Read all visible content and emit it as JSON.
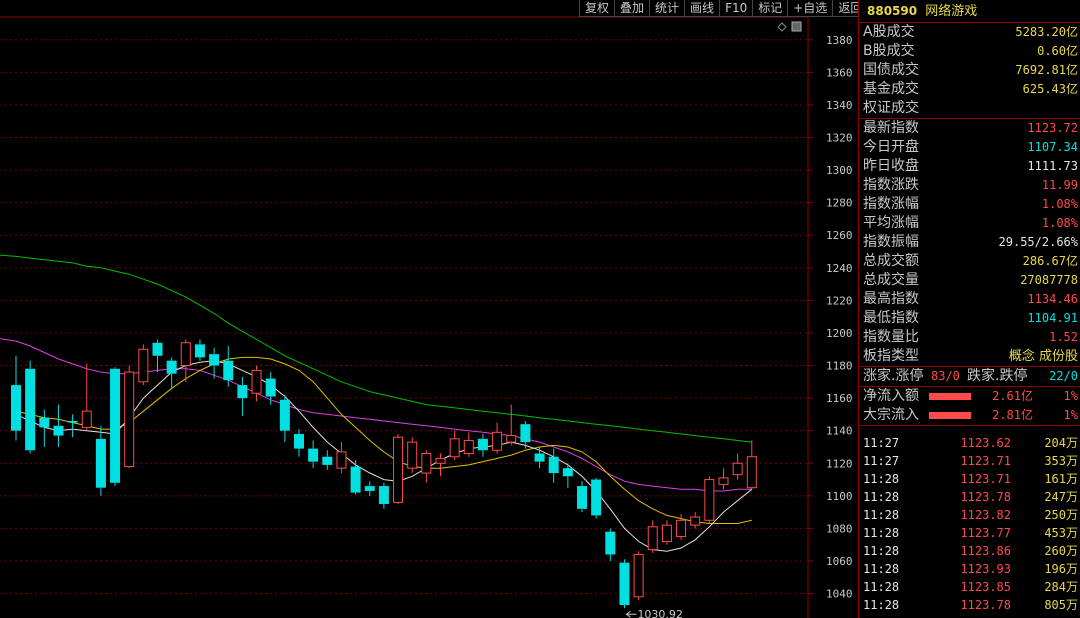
{
  "toolbar": [
    "复权",
    "叠加",
    "统计",
    "画线",
    "F10",
    "标记",
    "+自选",
    "返回"
  ],
  "panel": {
    "code": "880590",
    "name": "网络游戏",
    "turnover": [
      {
        "label": "A股成交",
        "value": "5283.20亿"
      },
      {
        "label": "B股成交",
        "value": "0.60亿"
      },
      {
        "label": "国债成交",
        "value": "7692.81亿"
      },
      {
        "label": "基金成交",
        "value": "625.43亿"
      },
      {
        "label": "权证成交",
        "value": ""
      }
    ],
    "stats": [
      {
        "label": "最新指数",
        "value": "1123.72",
        "color": "r"
      },
      {
        "label": "今日开盘",
        "value": "1107.34",
        "color": "c"
      },
      {
        "label": "昨日收盘",
        "value": "1111.73",
        "color": "w"
      },
      {
        "label": "指数涨跌",
        "value": "11.99",
        "color": "r"
      },
      {
        "label": "指数涨幅",
        "value": "1.08%",
        "color": "r"
      },
      {
        "label": "平均涨幅",
        "value": "1.08%",
        "color": "r"
      },
      {
        "label": "指数振幅",
        "value": "29.55/2.66%",
        "color": "w"
      },
      {
        "label": "总成交额",
        "value": "286.67亿",
        "color": "y"
      },
      {
        "label": "总成交量",
        "value": "27087778",
        "color": "y"
      },
      {
        "label": "最高指数",
        "value": "1134.46",
        "color": "r"
      },
      {
        "label": "最低指数",
        "value": "1104.91",
        "color": "c"
      },
      {
        "label": "指数量比",
        "value": "1.52",
        "color": "r"
      },
      {
        "label": "板指类型",
        "value": "概念 成份股",
        "color": "y"
      }
    ],
    "updown": {
      "up_label": "涨家.涨停",
      "up_value": "83/0",
      "down_label": "跌家.跌停",
      "down_value": "22/0"
    },
    "flows": [
      {
        "label": "净流入额",
        "amount": "2.61亿",
        "pct": "1%"
      },
      {
        "label": "大宗流入",
        "amount": "2.81亿",
        "pct": "1%"
      }
    ],
    "ticks": [
      {
        "time": "11:27",
        "price": "1123.62",
        "vol": "204万"
      },
      {
        "time": "11:27",
        "price": "1123.71",
        "vol": "353万"
      },
      {
        "time": "11:28",
        "price": "1123.71",
        "vol": "161万"
      },
      {
        "time": "11:28",
        "price": "1123.78",
        "vol": "247万"
      },
      {
        "time": "11:28",
        "price": "1123.82",
        "vol": "250万"
      },
      {
        "time": "11:28",
        "price": "1123.77",
        "vol": "453万"
      },
      {
        "time": "11:28",
        "price": "1123.86",
        "vol": "260万"
      },
      {
        "time": "11:28",
        "price": "1123.93",
        "vol": "196万"
      },
      {
        "time": "11:28",
        "price": "1123.85",
        "vol": "284万"
      },
      {
        "time": "11:28",
        "price": "1123.78",
        "vol": "805万"
      }
    ]
  },
  "chart_data": {
    "type": "candlestick",
    "ylim": [
      1025,
      1394
    ],
    "yticks": [
      1040,
      1060,
      1080,
      1100,
      1120,
      1140,
      1160,
      1180,
      1200,
      1220,
      1240,
      1260,
      1280,
      1300,
      1320,
      1340,
      1360,
      1380
    ],
    "low_annotation": "1030.92",
    "candles": [
      {
        "o": 1168,
        "c": 1140,
        "h": 1186,
        "l": 1134
      },
      {
        "o": 1178,
        "c": 1128,
        "h": 1183,
        "l": 1126
      },
      {
        "o": 1148,
        "c": 1142,
        "h": 1153,
        "l": 1130
      },
      {
        "o": 1143,
        "c": 1137,
        "h": 1156,
        "l": 1130
      },
      {
        "o": 1146,
        "c": 1145,
        "h": 1150,
        "l": 1136
      },
      {
        "o": 1142,
        "c": 1152,
        "h": 1181,
        "l": 1140
      },
      {
        "o": 1135,
        "c": 1105,
        "h": 1143,
        "l": 1100
      },
      {
        "o": 1178,
        "c": 1108,
        "h": 1179,
        "l": 1106
      },
      {
        "o": 1118,
        "c": 1176,
        "h": 1180,
        "l": 1117
      },
      {
        "o": 1170,
        "c": 1190,
        "h": 1193,
        "l": 1168
      },
      {
        "o": 1194,
        "c": 1186,
        "h": 1196,
        "l": 1176
      },
      {
        "o": 1183,
        "c": 1175,
        "h": 1185,
        "l": 1166
      },
      {
        "o": 1180,
        "c": 1194,
        "h": 1196,
        "l": 1170
      },
      {
        "o": 1193,
        "c": 1185,
        "h": 1196,
        "l": 1183
      },
      {
        "o": 1187,
        "c": 1180,
        "h": 1191,
        "l": 1172
      },
      {
        "o": 1183,
        "c": 1171,
        "h": 1192,
        "l": 1167
      },
      {
        "o": 1168,
        "c": 1160,
        "h": 1173,
        "l": 1149
      },
      {
        "o": 1163,
        "c": 1177,
        "h": 1180,
        "l": 1158
      },
      {
        "o": 1172,
        "c": 1161,
        "h": 1176,
        "l": 1156
      },
      {
        "o": 1159,
        "c": 1140,
        "h": 1162,
        "l": 1133
      },
      {
        "o": 1138,
        "c": 1129,
        "h": 1141,
        "l": 1124
      },
      {
        "o": 1129,
        "c": 1121,
        "h": 1134,
        "l": 1117
      },
      {
        "o": 1124,
        "c": 1119,
        "h": 1128,
        "l": 1116
      },
      {
        "o": 1117,
        "c": 1127,
        "h": 1133,
        "l": 1114
      },
      {
        "o": 1118,
        "c": 1102,
        "h": 1122,
        "l": 1101
      },
      {
        "o": 1106,
        "c": 1103,
        "h": 1109,
        "l": 1100
      },
      {
        "o": 1106,
        "c": 1095,
        "h": 1108,
        "l": 1092
      },
      {
        "o": 1096,
        "c": 1136,
        "h": 1138,
        "l": 1095
      },
      {
        "o": 1117,
        "c": 1133,
        "h": 1136,
        "l": 1114
      },
      {
        "o": 1114,
        "c": 1126,
        "h": 1128,
        "l": 1108
      },
      {
        "o": 1120,
        "c": 1123,
        "h": 1126,
        "l": 1112
      },
      {
        "o": 1124,
        "c": 1135,
        "h": 1140,
        "l": 1122
      },
      {
        "o": 1126,
        "c": 1134,
        "h": 1139,
        "l": 1124
      },
      {
        "o": 1135,
        "c": 1128,
        "h": 1138,
        "l": 1124
      },
      {
        "o": 1128,
        "c": 1139,
        "h": 1145,
        "l": 1126
      },
      {
        "o": 1133,
        "c": 1137,
        "h": 1156,
        "l": 1131
      },
      {
        "o": 1144,
        "c": 1133,
        "h": 1146,
        "l": 1129
      },
      {
        "o": 1126,
        "c": 1121,
        "h": 1130,
        "l": 1117
      },
      {
        "o": 1124,
        "c": 1114,
        "h": 1129,
        "l": 1108
      },
      {
        "o": 1117,
        "c": 1112,
        "h": 1120,
        "l": 1105
      },
      {
        "o": 1106,
        "c": 1092,
        "h": 1109,
        "l": 1090
      },
      {
        "o": 1110,
        "c": 1088,
        "h": 1111,
        "l": 1086
      },
      {
        "o": 1078,
        "c": 1064,
        "h": 1080,
        "l": 1060
      },
      {
        "o": 1059,
        "c": 1033,
        "h": 1061,
        "l": 1031
      },
      {
        "o": 1038,
        "c": 1064,
        "h": 1066,
        "l": 1036
      },
      {
        "o": 1067,
        "c": 1081,
        "h": 1085,
        "l": 1065
      },
      {
        "o": 1072,
        "c": 1082,
        "h": 1085,
        "l": 1070
      },
      {
        "o": 1075,
        "c": 1085,
        "h": 1089,
        "l": 1073
      },
      {
        "o": 1082,
        "c": 1087,
        "h": 1090,
        "l": 1080
      },
      {
        "o": 1085,
        "c": 1110,
        "h": 1112,
        "l": 1083
      },
      {
        "o": 1107,
        "c": 1111,
        "h": 1117,
        "l": 1104
      },
      {
        "o": 1113,
        "c": 1120,
        "h": 1126,
        "l": 1110
      },
      {
        "o": 1105,
        "c": 1124,
        "h": 1134,
        "l": 1104
      }
    ],
    "ma_white": [
      1150,
      1146,
      1142,
      1140,
      1141,
      1140,
      1139,
      1138,
      1148,
      1160,
      1168,
      1176,
      1180,
      1182,
      1183,
      1181,
      1177,
      1173,
      1168,
      1161,
      1152,
      1142,
      1133,
      1126,
      1119,
      1114,
      1110,
      1109,
      1112,
      1117,
      1122,
      1126,
      1129,
      1130,
      1131,
      1133,
      1131,
      1128,
      1124,
      1119,
      1112,
      1103,
      1092,
      1080,
      1072,
      1067,
      1066,
      1068,
      1073,
      1081,
      1090,
      1097,
      1104
    ],
    "ma_yellow": [
      1152,
      1150,
      1148,
      1147,
      1145,
      1143,
      1141,
      1141,
      1145,
      1152,
      1159,
      1166,
      1172,
      1177,
      1181,
      1184,
      1185,
      1185,
      1184,
      1181,
      1177,
      1170,
      1160,
      1150,
      1142,
      1134,
      1127,
      1121,
      1118,
      1117,
      1117,
      1118,
      1119,
      1121,
      1123,
      1125,
      1128,
      1130,
      1131,
      1130,
      1127,
      1121,
      1112,
      1104,
      1097,
      1092,
      1088,
      1086,
      1084,
      1083,
      1083,
      1083,
      1085
    ],
    "ma_magenta": [
      1195,
      1192,
      1188,
      1184,
      1181,
      1178,
      1176,
      1175,
      1175,
      1176,
      1177,
      1178,
      1178,
      1177,
      1174,
      1171,
      1167,
      1163,
      1159,
      1156,
      1153,
      1151,
      1150,
      1149,
      1148,
      1147,
      1146,
      1145,
      1144,
      1143,
      1142,
      1141,
      1140,
      1139,
      1138,
      1137,
      1135,
      1133,
      1130,
      1127,
      1123,
      1118,
      1113,
      1109,
      1107,
      1106,
      1105,
      1104,
      1104,
      1103,
      1103,
      1104,
      1104
    ],
    "ma_green": [
      1247,
      1246,
      1245,
      1244,
      1243,
      1241,
      1240,
      1238,
      1236,
      1233,
      1230,
      1226,
      1222,
      1217,
      1212,
      1206,
      1201,
      1196,
      1191,
      1186,
      1182,
      1178,
      1174,
      1170,
      1167,
      1164,
      1162,
      1160,
      1158,
      1156,
      1155,
      1154,
      1153,
      1152,
      1151,
      1150,
      1149,
      1148,
      1147,
      1146,
      1145,
      1144,
      1143,
      1142,
      1141,
      1140,
      1139,
      1138,
      1137,
      1136,
      1135,
      1134,
      1133
    ]
  }
}
